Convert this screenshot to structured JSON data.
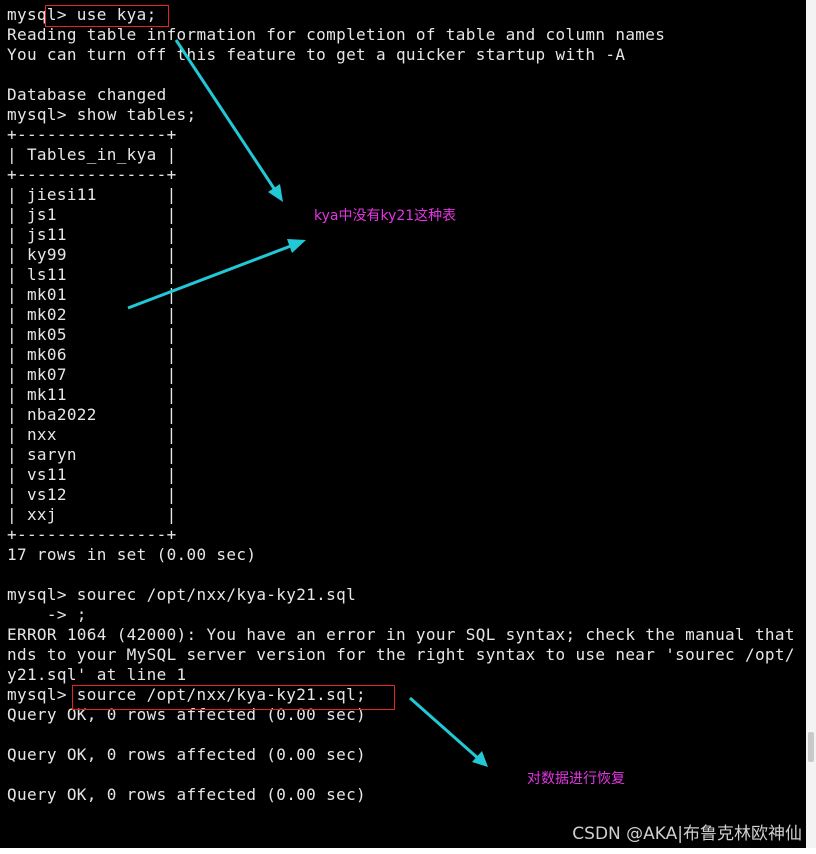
{
  "terminal": {
    "lines": [
      "mysql> use kya;",
      "Reading table information for completion of table and column names",
      "You can turn off this feature to get a quicker startup with -A",
      "",
      "Database changed",
      "mysql> show tables;",
      "+---------------+",
      "| Tables_in_kya |",
      "+---------------+",
      "| jiesi11       |",
      "| js1           |",
      "| js11          |",
      "| ky99          |",
      "| ls11          |",
      "| mk01          |",
      "| mk02          |",
      "| mk05          |",
      "| mk06          |",
      "| mk07          |",
      "| mk11          |",
      "| nba2022       |",
      "| nxx           |",
      "| saryn         |",
      "| vs11          |",
      "| vs12          |",
      "| xxj           |",
      "+---------------+",
      "17 rows in set (0.00 sec)",
      "",
      "mysql> sourec /opt/nxx/kya-ky21.sql",
      "    -> ;",
      "ERROR 1064 (42000): You have an error in your SQL syntax; check the manual that",
      "nds to your MySQL server version for the right syntax to use near 'sourec /opt/",
      "y21.sql' at line 1",
      "mysql> source /opt/nxx/kya-ky21.sql;",
      "Query OK, 0 rows affected (0.00 sec)",
      "",
      "Query OK, 0 rows affected (0.00 sec)",
      "",
      "Query OK, 0 rows affected (0.00 sec)",
      ""
    ]
  },
  "annotations": {
    "no_table_note": "kya中没有ky21这种表",
    "restore_note": "对数据进行恢复",
    "watermark": "CSDN @AKA|布鲁克林欧神仙"
  },
  "colors": {
    "terminal_bg": "#000000",
    "terminal_text": "#e6e6e6",
    "highlight_box": "#e32424",
    "annotation_text": "#e236e2",
    "arrow": "#22c8d6"
  }
}
